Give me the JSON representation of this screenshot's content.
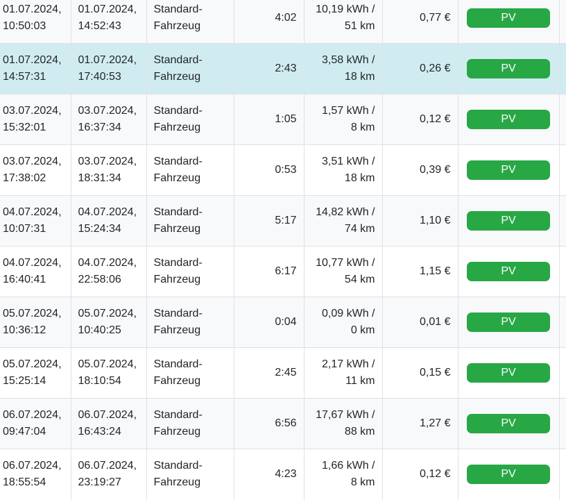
{
  "sessions": [
    {
      "start_date": "01.07.2024,",
      "start_time": "10:50:03",
      "end_date": "01.07.2024,",
      "end_time": "14:52:43",
      "vehicle_line1": "Standard-",
      "vehicle_line2": "Fahrzeug",
      "duration": "4:02",
      "energy": "10,19 kWh /",
      "distance": "51 km",
      "cost": "0,77 €",
      "source": "PV"
    },
    {
      "start_date": "01.07.2024,",
      "start_time": "14:57:31",
      "end_date": "01.07.2024,",
      "end_time": "17:40:53",
      "vehicle_line1": "Standard-",
      "vehicle_line2": "Fahrzeug",
      "duration": "2:43",
      "energy": "3,58 kWh /",
      "distance": "18 km",
      "cost": "0,26 €",
      "source": "PV"
    },
    {
      "start_date": "03.07.2024,",
      "start_time": "15:32:01",
      "end_date": "03.07.2024,",
      "end_time": "16:37:34",
      "vehicle_line1": "Standard-",
      "vehicle_line2": "Fahrzeug",
      "duration": "1:05",
      "energy": "1,57 kWh /",
      "distance": "8 km",
      "cost": "0,12 €",
      "source": "PV"
    },
    {
      "start_date": "03.07.2024,",
      "start_time": "17:38:02",
      "end_date": "03.07.2024,",
      "end_time": "18:31:34",
      "vehicle_line1": "Standard-",
      "vehicle_line2": "Fahrzeug",
      "duration": "0:53",
      "energy": "3,51 kWh /",
      "distance": "18 km",
      "cost": "0,39 €",
      "source": "PV"
    },
    {
      "start_date": "04.07.2024,",
      "start_time": "10:07:31",
      "end_date": "04.07.2024,",
      "end_time": "15:24:34",
      "vehicle_line1": "Standard-",
      "vehicle_line2": "Fahrzeug",
      "duration": "5:17",
      "energy": "14,82 kWh /",
      "distance": "74 km",
      "cost": "1,10 €",
      "source": "PV"
    },
    {
      "start_date": "04.07.2024,",
      "start_time": "16:40:41",
      "end_date": "04.07.2024,",
      "end_time": "22:58:06",
      "vehicle_line1": "Standard-",
      "vehicle_line2": "Fahrzeug",
      "duration": "6:17",
      "energy": "10,77 kWh /",
      "distance": "54 km",
      "cost": "1,15 €",
      "source": "PV"
    },
    {
      "start_date": "05.07.2024,",
      "start_time": "10:36:12",
      "end_date": "05.07.2024,",
      "end_time": "10:40:25",
      "vehicle_line1": "Standard-",
      "vehicle_line2": "Fahrzeug",
      "duration": "0:04",
      "energy": "0,09 kWh /",
      "distance": "0 km",
      "cost": "0,01 €",
      "source": "PV"
    },
    {
      "start_date": "05.07.2024,",
      "start_time": "15:25:14",
      "end_date": "05.07.2024,",
      "end_time": "18:10:54",
      "vehicle_line1": "Standard-",
      "vehicle_line2": "Fahrzeug",
      "duration": "2:45",
      "energy": "2,17 kWh /",
      "distance": "11 km",
      "cost": "0,15 €",
      "source": "PV"
    },
    {
      "start_date": "06.07.2024,",
      "start_time": "09:47:04",
      "end_date": "06.07.2024,",
      "end_time": "16:43:24",
      "vehicle_line1": "Standard-",
      "vehicle_line2": "Fahrzeug",
      "duration": "6:56",
      "energy": "17,67 kWh /",
      "distance": "88 km",
      "cost": "1,27 €",
      "source": "PV"
    },
    {
      "start_date": "06.07.2024,",
      "start_time": "18:55:54",
      "end_date": "06.07.2024,",
      "end_time": "23:19:27",
      "vehicle_line1": "Standard-",
      "vehicle_line2": "Fahrzeug",
      "duration": "4:23",
      "energy": "1,66 kWh /",
      "distance": "8 km",
      "cost": "0,12 €",
      "source": "PV"
    }
  ],
  "colors": {
    "row_odd": "#f8f9fa",
    "row_even": "#ffffff",
    "row_hover": "#d1ecf1",
    "badge_pv": "#28a745",
    "border": "#dee2e6"
  }
}
